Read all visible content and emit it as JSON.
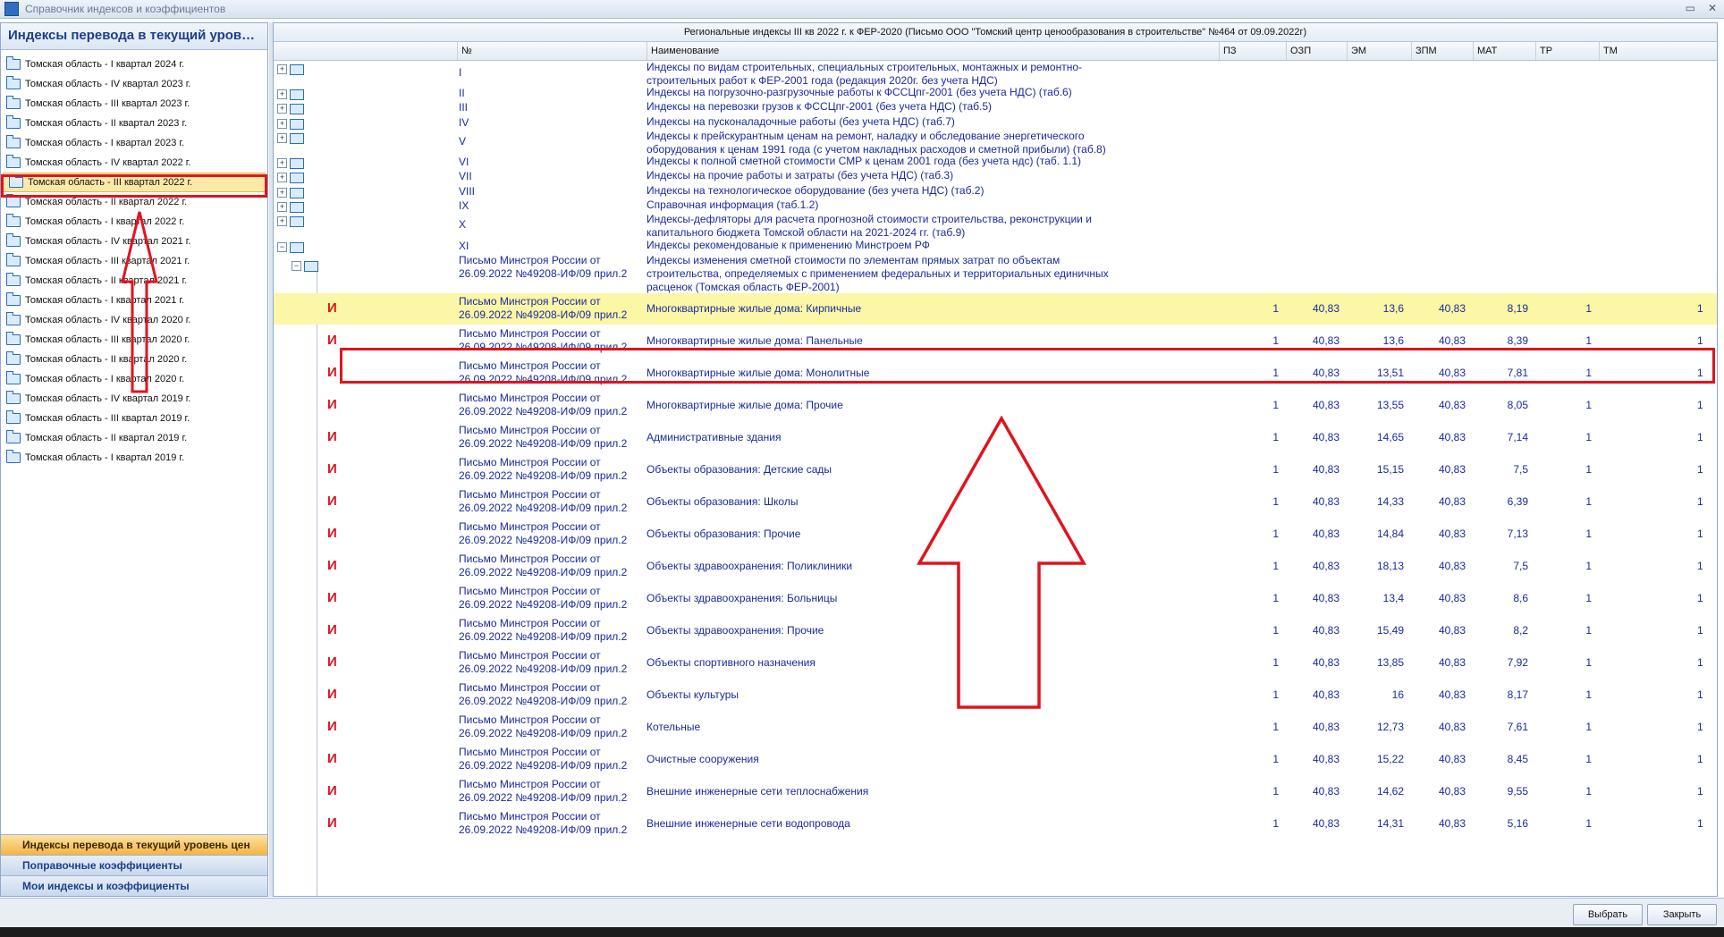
{
  "window": {
    "title": "Справочник индексов и коэффициентов",
    "controls": [
      "▭",
      "✕"
    ]
  },
  "left_panel": {
    "header": "Индексы перевода в текущий уровень цен",
    "items": [
      "Томская область - I квартал 2024 г.",
      "Томская область - IV квартал 2023 г.",
      "Томская область - III квартал 2023 г.",
      "Томская область - II квартал 2023 г.",
      "Томская область - I квартал 2023 г.",
      "Томская область - IV квартал 2022 г.",
      "Томская область - III квартал 2022 г.",
      "Томская область - II квартал 2022 г.",
      "Томская область - I квартал 2022 г.",
      "Томская область - IV квартал 2021 г.",
      "Томская область - III квартал 2021 г.",
      "Томская область - II квартал 2021 г.",
      "Томская область - I квартал 2021 г.",
      "Томская область - IV квартал 2020 г.",
      "Томская область - III квартал 2020 г.",
      "Томская область - II квартал 2020 г.",
      "Томская область - I квартал 2020 г.",
      "Томская область - IV квартал 2019 г.",
      "Томская область - III квартал 2019 г.",
      "Томская область - II квартал 2019 г.",
      "Томская область - I квартал 2019 г."
    ],
    "selected_index": 6,
    "nav": [
      "Индексы перевода в текущий уровень цен",
      "Поправочные коэффициенты",
      "Мои индексы и коэффициенты"
    ]
  },
  "grid": {
    "caption": "Региональные индексы III кв 2022 г. к ФЕР-2020 (Письмо ООО \"Томский центр ценообразования в строительстве\" №464 от 09.09.2022г)",
    "columns": [
      "№",
      "Наименование",
      "ПЗ",
      "ОЗП",
      "ЭМ",
      "ЗПМ",
      "МАТ",
      "ТР",
      "ТМ"
    ],
    "groups": [
      {
        "num": "I",
        "name": "Индексы по видам строительных, специальных строительных, монтажных и ремонтно-строительных работ к ФЕР-2001 года (редакция 2020г. без учета НДС)"
      },
      {
        "num": "II",
        "name": "Индексы на погрузочно-разгрузочные работы к ФССЦпг-2001 (без учета НДС) (таб.6)"
      },
      {
        "num": "III",
        "name": "Индексы на перевозки грузов к ФССЦпг-2001 (без учета НДС) (таб.5)"
      },
      {
        "num": "IV",
        "name": "Индексы на пусконаладочные работы (без учета НДС) (таб.7)"
      },
      {
        "num": "V",
        "name": "Индексы к прейскурантным ценам на ремонт, наладку и обследование энергетического оборудования к ценам 1991 года (с учетом накладных расходов и сметной прибыли) (таб.8)"
      },
      {
        "num": "VI",
        "name": "Индексы к полной сметной стоимости СМР к ценам 2001 года (без учета ндс) (таб. 1.1)"
      },
      {
        "num": "VII",
        "name": "Индексы на прочие работы и затраты (без учета НДС) (таб.3)"
      },
      {
        "num": "VIII",
        "name": "Индексы на технологическое оборудование (без учета НДС) (таб.2)"
      },
      {
        "num": "IX",
        "name": "Справочная информация (таб.1.2)"
      },
      {
        "num": "X",
        "name": "Индексы-дефляторы для расчета прогнозной стоимости строительства, реконструкции и капитального бюджета Томской области на 2021-2024 гг. (таб.9)"
      },
      {
        "num": "XI",
        "name": "Индексы рекомендованые к применению Минстроем РФ"
      }
    ],
    "subgroup": {
      "num": "Письмо Минстроя России от 26.09.2022 №49208-ИФ/09 прил.2",
      "name": "Индексы изменения сметной стоимости по элементам прямых затрат по объектам строительства, определяемых с применением федеральных и территориальных единичных расценок (Томская область ФЕР-2001)"
    },
    "item_marker": "И",
    "item_num": "Письмо Минстроя России от 26.09.2022 №49208-ИФ/09 прил.2",
    "items": [
      {
        "name": "Многоквартирные жилые дома: Кирпичные",
        "pz": "1",
        "ozp": "40,83",
        "em": "13,6",
        "zpm": "40,83",
        "mat": "8,19",
        "tr": "1",
        "tm": "1"
      },
      {
        "name": "Многоквартирные жилые дома: Панельные",
        "pz": "1",
        "ozp": "40,83",
        "em": "13,6",
        "zpm": "40,83",
        "mat": "8,39",
        "tr": "1",
        "tm": "1"
      },
      {
        "name": "Многоквартирные жилые дома: Монолитные",
        "pz": "1",
        "ozp": "40,83",
        "em": "13,51",
        "zpm": "40,83",
        "mat": "7,81",
        "tr": "1",
        "tm": "1"
      },
      {
        "name": "Многоквартирные жилые дома: Прочие",
        "pz": "1",
        "ozp": "40,83",
        "em": "13,55",
        "zpm": "40,83",
        "mat": "8,05",
        "tr": "1",
        "tm": "1"
      },
      {
        "name": "Административные здания",
        "pz": "1",
        "ozp": "40,83",
        "em": "14,65",
        "zpm": "40,83",
        "mat": "7,14",
        "tr": "1",
        "tm": "1"
      },
      {
        "name": "Объекты образования: Детские сады",
        "pz": "1",
        "ozp": "40,83",
        "em": "15,15",
        "zpm": "40,83",
        "mat": "7,5",
        "tr": "1",
        "tm": "1"
      },
      {
        "name": "Объекты образования: Школы",
        "pz": "1",
        "ozp": "40,83",
        "em": "14,33",
        "zpm": "40,83",
        "mat": "6,39",
        "tr": "1",
        "tm": "1"
      },
      {
        "name": "Объекты образования: Прочие",
        "pz": "1",
        "ozp": "40,83",
        "em": "14,84",
        "zpm": "40,83",
        "mat": "7,13",
        "tr": "1",
        "tm": "1"
      },
      {
        "name": "Объекты здравоохранения: Поликлиники",
        "pz": "1",
        "ozp": "40,83",
        "em": "18,13",
        "zpm": "40,83",
        "mat": "7,5",
        "tr": "1",
        "tm": "1"
      },
      {
        "name": "Объекты здравоохранения: Больницы",
        "pz": "1",
        "ozp": "40,83",
        "em": "13,4",
        "zpm": "40,83",
        "mat": "8,6",
        "tr": "1",
        "tm": "1"
      },
      {
        "name": "Объекты здравоохранения: Прочие",
        "pz": "1",
        "ozp": "40,83",
        "em": "15,49",
        "zpm": "40,83",
        "mat": "8,2",
        "tr": "1",
        "tm": "1"
      },
      {
        "name": "Объекты спортивного назначения",
        "pz": "1",
        "ozp": "40,83",
        "em": "13,85",
        "zpm": "40,83",
        "mat": "7,92",
        "tr": "1",
        "tm": "1"
      },
      {
        "name": "Объекты культуры",
        "pz": "1",
        "ozp": "40,83",
        "em": "16",
        "zpm": "40,83",
        "mat": "8,17",
        "tr": "1",
        "tm": "1"
      },
      {
        "name": "Котельные",
        "pz": "1",
        "ozp": "40,83",
        "em": "12,73",
        "zpm": "40,83",
        "mat": "7,61",
        "tr": "1",
        "tm": "1"
      },
      {
        "name": "Очистные сооружения",
        "pz": "1",
        "ozp": "40,83",
        "em": "15,22",
        "zpm": "40,83",
        "mat": "8,45",
        "tr": "1",
        "tm": "1"
      },
      {
        "name": "Внешние инженерные сети теплоснабжения",
        "pz": "1",
        "ozp": "40,83",
        "em": "14,62",
        "zpm": "40,83",
        "mat": "9,55",
        "tr": "1",
        "tm": "1"
      },
      {
        "name": "Внешние инженерные сети водопровода",
        "pz": "1",
        "ozp": "40,83",
        "em": "14,31",
        "zpm": "40,83",
        "mat": "5,16",
        "tr": "1",
        "tm": "1"
      }
    ],
    "highlighted_item_index": 0
  },
  "footer": {
    "select_button": "Выбрать",
    "close_button": "Закрыть"
  },
  "colors": {
    "highlight_row": "#fbf7a6",
    "annotation_red": "#e0141e",
    "selected_quarter": "#fbe9a8",
    "text_blue": "#1a2a9c"
  }
}
